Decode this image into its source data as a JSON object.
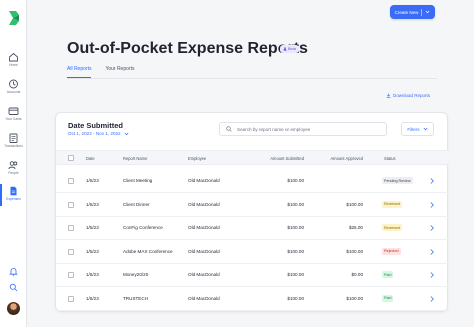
{
  "sidebar": {
    "items": [
      {
        "label": "Home",
        "icon": "home-icon"
      },
      {
        "label": "Accounts",
        "icon": "accounts-icon"
      },
      {
        "label": "Your Cards",
        "icon": "cards-icon"
      },
      {
        "label": "Transactions",
        "icon": "transactions-icon"
      },
      {
        "label": "People",
        "icon": "people-icon"
      },
      {
        "label": "Expenses",
        "icon": "expenses-icon",
        "active": true
      }
    ]
  },
  "header": {
    "create_label": "Create New",
    "title": "Out-of-Pocket Expense Reports",
    "beta_label": "Beta"
  },
  "tabs": [
    {
      "label": "All Reports",
      "active": true
    },
    {
      "label": "Your Reports",
      "active": false
    }
  ],
  "download_label": "Download Reports",
  "card": {
    "date_title": "Date Submitted",
    "date_range": "Oct 1, 2022 - Nov 1, 2022",
    "search_placeholder": "Search by report name or employee",
    "filters_label": "Filters"
  },
  "table": {
    "columns": [
      "Date",
      "Report Name",
      "Employee",
      "Amount Submitted",
      "Amount Approved",
      "Status"
    ],
    "rows": [
      {
        "date": "1/5/23",
        "report": "Client Meeting",
        "employee": "Old MacDonald",
        "submitted": "$100.00",
        "approved": "",
        "status": "Pending Review"
      },
      {
        "date": "1/5/23",
        "report": "Client Dinner",
        "employee": "Old MacDonald",
        "submitted": "$100.00",
        "approved": "$100.00",
        "status": "Reviewed"
      },
      {
        "date": "1/5/23",
        "report": "ConFig Conference",
        "employee": "Old MacDonald",
        "submitted": "$100.00",
        "approved": "$25.00",
        "status": "Reviewed"
      },
      {
        "date": "1/5/23",
        "report": "Adobe MAX Conference",
        "employee": "Old MacDonald",
        "submitted": "$100.00",
        "approved": "$100.00",
        "status": "Rejected"
      },
      {
        "date": "1/5/23",
        "report": "Money20/20",
        "employee": "Old MacDonald",
        "submitted": "$100.00",
        "approved": "$0.00",
        "status": "Paid"
      },
      {
        "date": "1/5/23",
        "report": "TRUSTECH",
        "employee": "Old MacDonald",
        "submitted": "$100.00",
        "approved": "$100.00",
        "status": "Paid"
      }
    ]
  },
  "status_colors": {
    "Pending Review": {
      "bg": "#eceef2",
      "fg": "#3d4350"
    },
    "Reviewed": {
      "bg": "#fdf3c7",
      "fg": "#8a6a00"
    },
    "Rejected": {
      "bg": "#fde2e2",
      "fg": "#c53030"
    },
    "Paid": {
      "bg": "#d9f5e4",
      "fg": "#1f8a4c"
    }
  },
  "colors": {
    "accent": "#3b6cf6",
    "brand": "#2fbf6f"
  }
}
